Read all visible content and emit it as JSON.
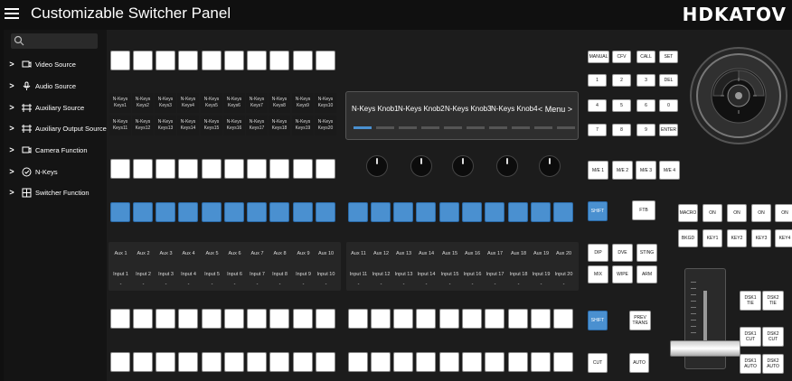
{
  "header": {
    "title": "Customizable Switcher Panel",
    "logo": "HDKATOV"
  },
  "sidebar": {
    "items": [
      {
        "label": "Video Source",
        "icon": "monitor-icon"
      },
      {
        "label": "Audio Source",
        "icon": "audio-icon"
      },
      {
        "label": "Auxiliary Source",
        "icon": "aux-icon"
      },
      {
        "label": "Auxiliary Output Source",
        "icon": "aux-output-icon"
      },
      {
        "label": "Camera Function",
        "icon": "camera-icon"
      },
      {
        "label": "N-Keys",
        "icon": "nkeys-icon"
      },
      {
        "label": "Switcher Function",
        "icon": "switcher-icon"
      }
    ]
  },
  "nkeys_row1": [
    "N-Keys Keys1",
    "N-Keys Keys2",
    "N-Keys Keys3",
    "N-Keys Keys4",
    "N-Keys Keys5",
    "N-Keys Keys6",
    "N-Keys Keys7",
    "N-Keys Keys8",
    "N-Keys Keys9",
    "N-Keys Keys10"
  ],
  "nkeys_row2": [
    "N-Keys Keys11",
    "N-Keys Keys12",
    "N-Keys Keys13",
    "N-Keys Keys14",
    "N-Keys Keys15",
    "N-Keys Keys16",
    "N-Keys Keys17",
    "N-Keys Keys18",
    "N-Keys Keys19",
    "N-Keys Keys20"
  ],
  "knob_display": {
    "labels": [
      "N-Keys Knob1",
      "N-Keys Knob2",
      "N-Keys Knob3",
      "N-Keys Knob4"
    ],
    "menu": "< Menu >"
  },
  "aux_left": [
    "Aux 1",
    "Aux 2",
    "Aux 3",
    "Aux 4",
    "Aux 5",
    "Aux 6",
    "Aux 7",
    "Aux 8",
    "Aux 9",
    "Aux 10"
  ],
  "aux_right": [
    "Aux 11",
    "Aux 12",
    "Aux 13",
    "Aux 14",
    "Aux 15",
    "Aux 16",
    "Aux 17",
    "Aux 18",
    "Aux 19",
    "Aux 20"
  ],
  "input_left": [
    "Input 1",
    "Input 2",
    "Input 3",
    "Input 4",
    "Input 5",
    "Input 6",
    "Input 7",
    "Input 8",
    "Input 9",
    "Input 10"
  ],
  "input_right": [
    "Input 11",
    "Input 12",
    "Input 13",
    "Input 14",
    "Input 15",
    "Input 16",
    "Input 17",
    "Input 18",
    "Input 19",
    "Input 20"
  ],
  "dash": "-",
  "keypad": {
    "row1": [
      "MANUAL",
      "CFV",
      "CALL",
      "SET"
    ],
    "row2": [
      "1",
      "2",
      "3",
      "DEL"
    ],
    "row3": [
      "4",
      "5",
      "6",
      "0"
    ],
    "row4": [
      "7",
      "8",
      "9",
      "ENTER"
    ]
  },
  "me": [
    "M/E 1",
    "M/E 2",
    "M/E 3",
    "M/E 4"
  ],
  "shift1": "SHIFT",
  "ftb": "FTB",
  "macro_row": [
    "MACRO",
    "ON",
    "ON",
    "ON",
    "ON"
  ],
  "key_row": [
    "BKGD",
    "KEY1",
    "KEY2",
    "KEY3",
    "KEY4"
  ],
  "trans": [
    "DIP",
    "DVE",
    "STING",
    "MIX",
    "WIPE",
    "ARM"
  ],
  "shift2": "SHIFT",
  "prev_trans": "PREV TRANS",
  "cut": "CUT",
  "auto": "AUTO",
  "dsk": [
    "DSK1 TIE",
    "DSK2 TIE",
    "DSK1 CUT",
    "DSK2 CUT",
    "DSK1 AUTO",
    "DSK2 AUTO"
  ]
}
